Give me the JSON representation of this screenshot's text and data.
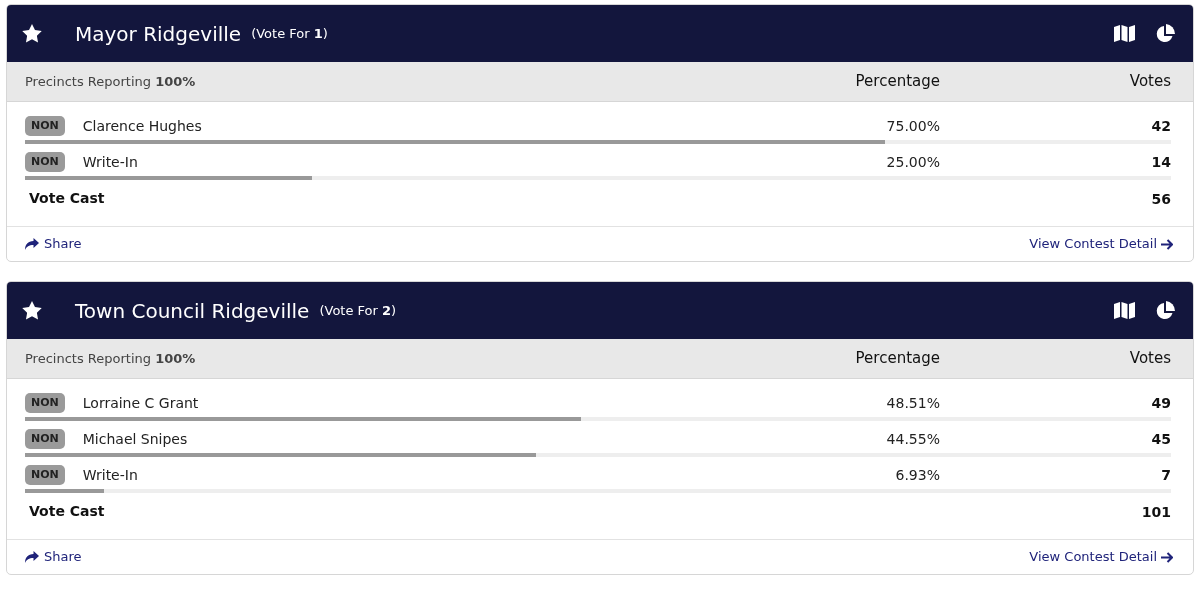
{
  "contests": [
    {
      "title": "Mayor Ridgeville",
      "vote_for": "(Vote For **1**)",
      "precincts": "Precincts Reporting **100%**",
      "percentage_heading": "Percentage",
      "votes_heading": "Votes",
      "candidates": [
        {
          "party": "NON",
          "name": "Clarence Hughes",
          "percentage": "75.00%",
          "votes": "42",
          "level": 0.75
        },
        {
          "party": "NON",
          "name": "Write-In",
          "percentage": "25.00%",
          "votes": "14",
          "level": 0.25
        }
      ],
      "total_label": "Vote Cast",
      "total": "56",
      "share": "Share",
      "detail": "View Contest Detail"
    },
    {
      "title": "Town Council Ridgeville",
      "vote_for": "(Vote For **2**)",
      "precincts": "Precincts Reporting **100%**",
      "percentage_heading": "Percentage",
      "votes_heading": "Votes",
      "candidates": [
        {
          "party": "NON",
          "name": "Lorraine C Grant",
          "percentage": "48.51%",
          "votes": "49",
          "level": 0.4851
        },
        {
          "party": "NON",
          "name": "Michael Snipes",
          "percentage": "44.55%",
          "votes": "45",
          "level": 0.4455
        },
        {
          "party": "NON",
          "name": "Write-In",
          "percentage": "6.93%",
          "votes": "7",
          "level": 0.0693
        }
      ],
      "total_label": "Vote Cast",
      "total": "101",
      "share": "Share",
      "detail": "View Contest Detail"
    }
  ]
}
